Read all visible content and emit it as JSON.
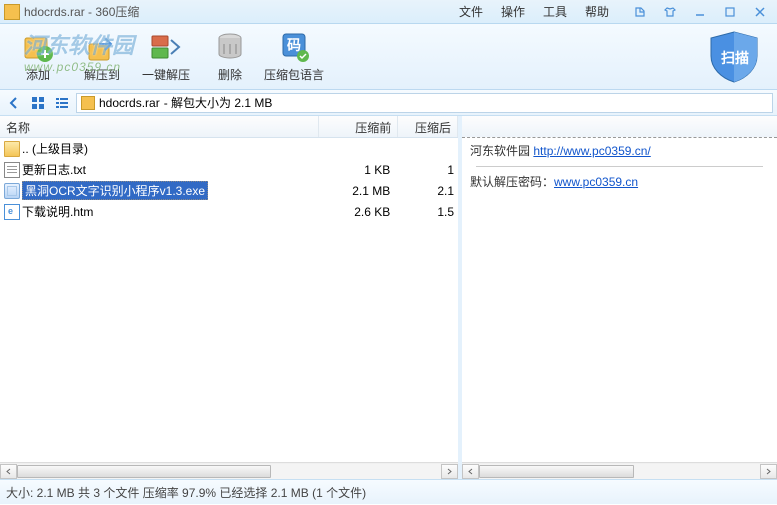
{
  "title": "hdocrds.rar - 360压缩",
  "menu": {
    "file": "文件",
    "operate": "操作",
    "tool": "工具",
    "help": "帮助"
  },
  "toolbar": {
    "add": "添加",
    "extract_to": "解压到",
    "extract_one": "一键解压",
    "delete": "删除",
    "lang": "压缩包语言",
    "scan": "扫描"
  },
  "watermark": {
    "main": "河东软件园",
    "sub": "www.pc0359.cn"
  },
  "path": {
    "archive": "hdocrds.rar",
    "desc": "- 解包大小为 2.1 MB"
  },
  "columns": {
    "name": "名称",
    "before": "压缩前",
    "after": "压缩后"
  },
  "rows": [
    {
      "icon": "folder",
      "name": ".. (上级目录)",
      "before": "",
      "after": "",
      "selected": false
    },
    {
      "icon": "txt",
      "name": "更新日志.txt",
      "before": "1 KB",
      "after": "1",
      "selected": false
    },
    {
      "icon": "exe",
      "name": "黑洞OCR文字识别小程序v1.3.exe",
      "before": "2.1 MB",
      "after": "2.1",
      "selected": true
    },
    {
      "icon": "htm",
      "name": "下载说明.htm",
      "before": "2.6 KB",
      "after": "1.5",
      "selected": false
    }
  ],
  "info": {
    "site_label": "河东软件园",
    "site_url": "http://www.pc0359.cn/",
    "pw_label": "默认解压密码：",
    "pw_url": "www.pc0359.cn"
  },
  "status": "大小: 2.1 MB 共 3 个文件 压缩率 97.9%  已经选择 2.1 MB (1 个文件)"
}
